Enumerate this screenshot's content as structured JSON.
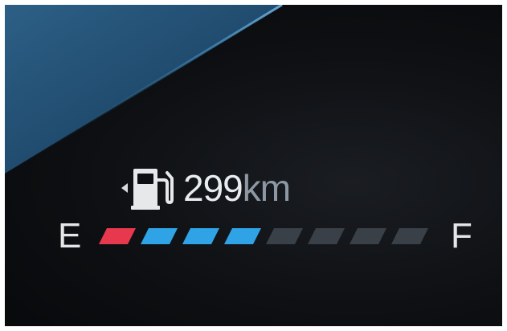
{
  "fuel": {
    "range_value": "299",
    "range_unit": "km",
    "empty_label": "E",
    "full_label": "F",
    "level_segments_lit": 4,
    "total_segments": 8,
    "low_segments": 1
  },
  "icons": {
    "fuel_pump": "fuel-pump-icon",
    "filler_side": "arrow-left-icon"
  },
  "colors": {
    "low": "#e8384d",
    "filled": "#2fa3e6",
    "empty": "#3a4047",
    "accent_sheen": "#2b6f9f"
  }
}
